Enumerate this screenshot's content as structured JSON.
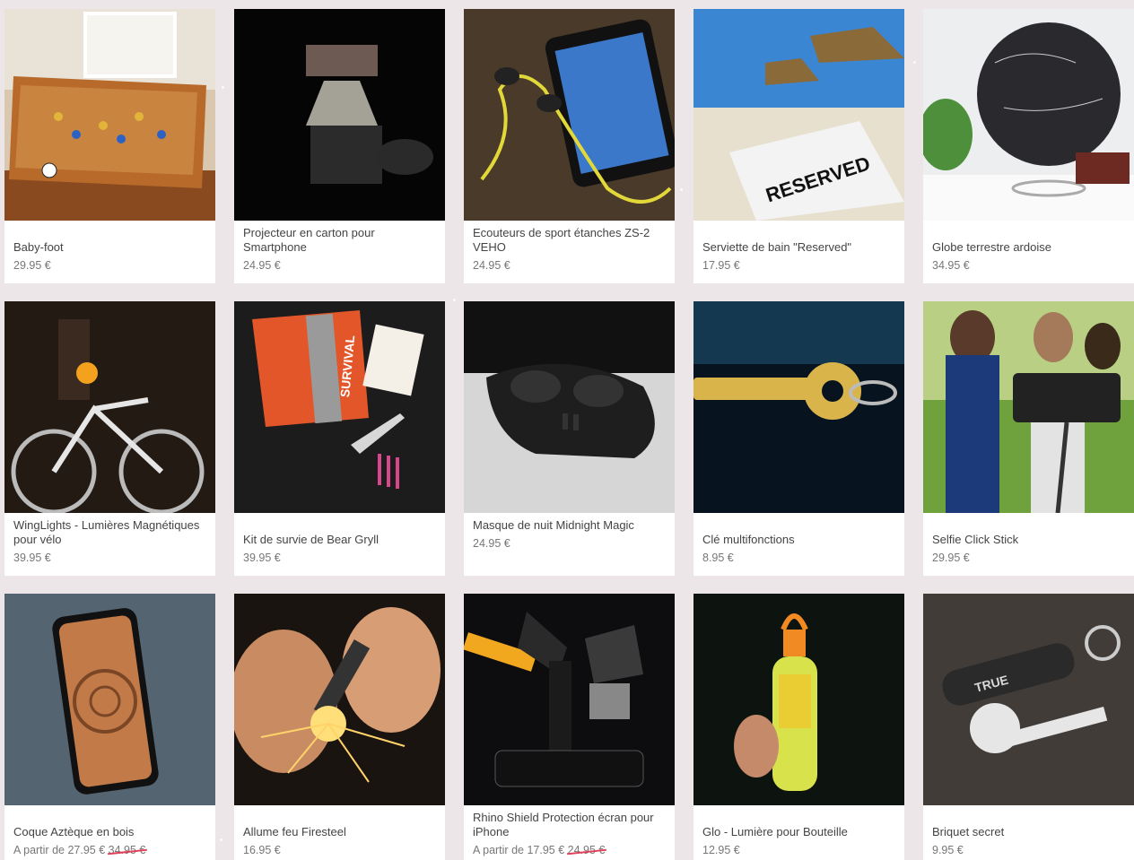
{
  "products": [
    {
      "name": "Baby-foot",
      "price": "29.95 €",
      "image": "table-football-photo"
    },
    {
      "name": "Projecteur en carton pour Smartphone",
      "price": "24.95 €",
      "image": "cardboard-projector-photo"
    },
    {
      "name": "Ecouteurs de sport étanches ZS-2 VEHO",
      "price": "24.95 €",
      "image": "sport-earphones-photo"
    },
    {
      "name": "Serviette de bain \"Reserved\"",
      "price": "17.95 €",
      "image": "beach-towel-photo",
      "overlay_text": "RESERVED"
    },
    {
      "name": "Globe terrestre ardoise",
      "price": "34.95 €",
      "image": "chalkboard-globe-photo"
    },
    {
      "name": "WingLights - Lumières Magnétiques pour vélo",
      "price": "39.95 €",
      "image": "bike-lights-photo"
    },
    {
      "name": "Kit de survie de Bear Gryll",
      "price": "39.95 €",
      "image": "survival-kit-photo",
      "overlay_text": "SURVIVAL"
    },
    {
      "name": "Masque de nuit Midnight Magic",
      "price": "24.95 €",
      "image": "sleep-mask-photo"
    },
    {
      "name": "Clé multifonctions",
      "price": "8.95 €",
      "image": "multitool-key-photo"
    },
    {
      "name": "Selfie Click Stick",
      "price": "29.95 €",
      "image": "selfie-stick-photo"
    },
    {
      "name": "Coque Aztèque en bois",
      "price_prefix": "A partir de",
      "price": "27.95 €",
      "old_price": "34.95 €",
      "image": "wooden-case-photo"
    },
    {
      "name": "Allume feu Firesteel",
      "price": "16.95 €",
      "image": "firesteel-photo"
    },
    {
      "name": "Rhino Shield Protection écran pour iPhone",
      "price_prefix": "A partir de",
      "price": "17.95 €",
      "old_price": "24.95 €",
      "image": "screen-protector-photo"
    },
    {
      "name": "Glo - Lumière pour Bouteille",
      "price": "12.95 €",
      "image": "bottle-light-photo"
    },
    {
      "name": "Briquet secret",
      "price": "9.95 €",
      "image": "secret-lighter-photo",
      "overlay_text": "TRUE"
    }
  ],
  "colors": {
    "price_strike": "#e0405a",
    "background": "#ece6e8"
  }
}
